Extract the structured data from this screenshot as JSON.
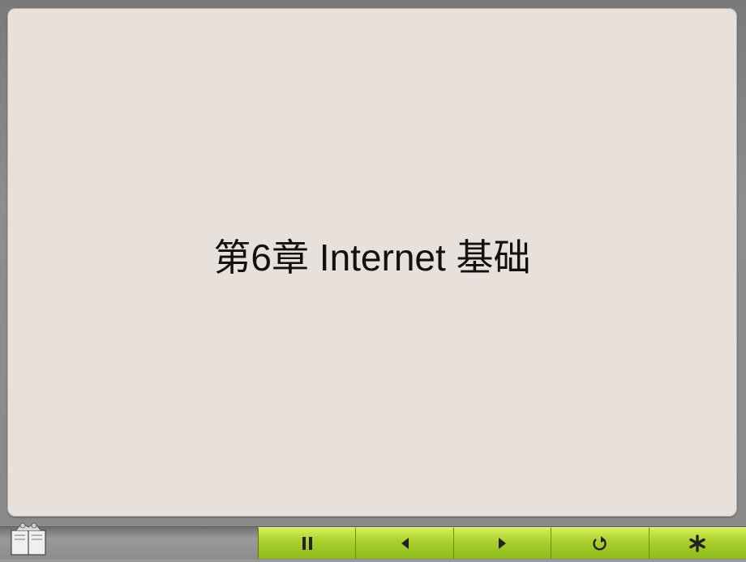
{
  "slide": {
    "title": "第6章 Internet 基础"
  },
  "toolbar": {
    "buttons": [
      {
        "name": "pause-button",
        "icon": "pause-icon"
      },
      {
        "name": "previous-button",
        "icon": "triangle-left-icon"
      },
      {
        "name": "next-button",
        "icon": "triangle-right-icon"
      },
      {
        "name": "replay-button",
        "icon": "replay-icon"
      },
      {
        "name": "end-show-button",
        "icon": "asterisk-icon"
      }
    ],
    "accent_color": "#a9cf2c"
  }
}
